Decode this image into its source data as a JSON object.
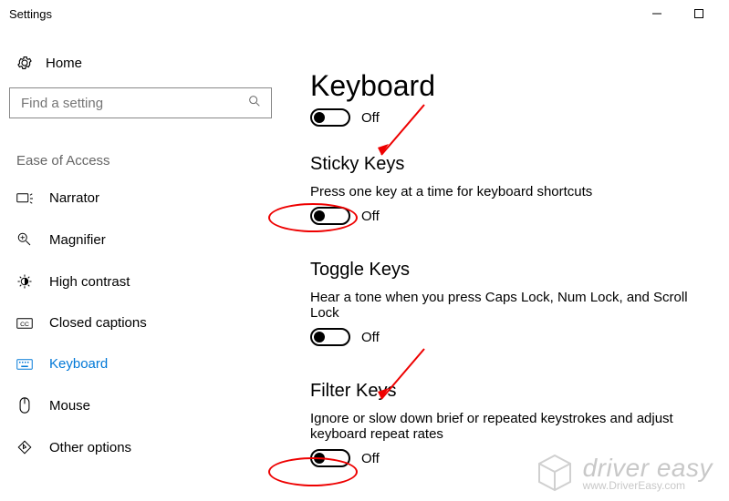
{
  "window": {
    "title": "Settings"
  },
  "left": {
    "home": "Home",
    "search_placeholder": "Find a setting",
    "category": "Ease of Access",
    "items": [
      {
        "label": "Narrator"
      },
      {
        "label": "Magnifier"
      },
      {
        "label": "High contrast"
      },
      {
        "label": "Closed captions"
      },
      {
        "label": "Keyboard"
      },
      {
        "label": "Mouse"
      },
      {
        "label": "Other options"
      }
    ]
  },
  "page": {
    "title": "Keyboard",
    "master": {
      "state": "Off"
    },
    "sections": [
      {
        "heading": "Sticky Keys",
        "desc": "Press one key at a time for keyboard shortcuts",
        "state": "Off"
      },
      {
        "heading": "Toggle Keys",
        "desc": "Hear a tone when you press Caps Lock, Num Lock, and Scroll Lock",
        "state": "Off"
      },
      {
        "heading": "Filter Keys",
        "desc": "Ignore or slow down brief or repeated keystrokes and adjust keyboard repeat rates",
        "state": "Off"
      }
    ]
  },
  "watermark": {
    "line1": "driver easy",
    "line2": "www.DriverEasy.com"
  }
}
